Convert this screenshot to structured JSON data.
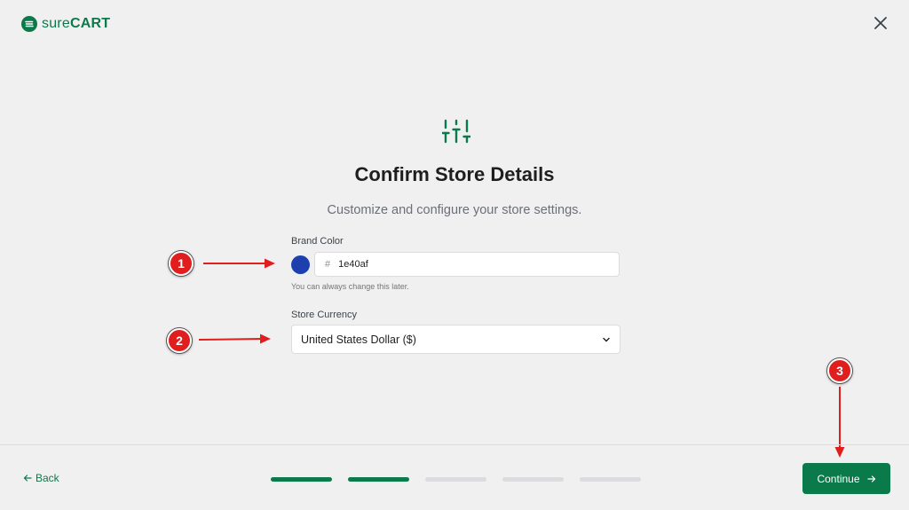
{
  "brand": {
    "name_part1": "sure",
    "name_part2": "CART",
    "logo_icon": "surecart-logo-icon",
    "color": "#0b7a4b"
  },
  "header": {
    "close_icon": "close-icon"
  },
  "main": {
    "icon": "sliders-icon",
    "title": "Confirm Store Details",
    "subtitle": "Customize and configure your store settings."
  },
  "form": {
    "brand_color": {
      "label": "Brand Color",
      "hash": "#",
      "value": "1e40af",
      "swatch_color": "#1e40af",
      "help": "You can always change this later."
    },
    "store_currency": {
      "label": "Store Currency",
      "selected": "United States Dollar ($)",
      "icon": "chevron-down-icon"
    }
  },
  "annotations": [
    {
      "number": "1"
    },
    {
      "number": "2"
    },
    {
      "number": "3"
    }
  ],
  "footer": {
    "back_label": "Back",
    "back_icon": "arrow-left-icon",
    "continue_label": "Continue",
    "continue_icon": "arrow-right-icon",
    "steps_total": 5,
    "steps_completed": 2
  }
}
